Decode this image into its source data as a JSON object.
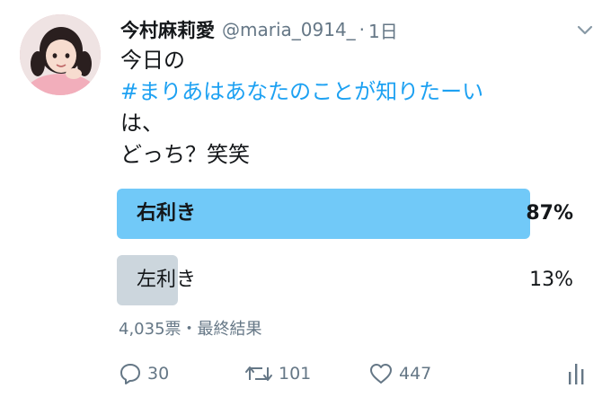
{
  "tweet": {
    "display_name": "今村麻莉愛",
    "handle": "@maria_0914_",
    "separator": "·",
    "time": "1日",
    "text_lines": [
      "今日の",
      "#まりあはあなたのことが知りたーい",
      "は、",
      "どっち？笑笑"
    ]
  },
  "poll": {
    "options": [
      {
        "label": "右利き",
        "percent_text": "87%",
        "percent": 87,
        "winner": true
      },
      {
        "label": "左利き",
        "percent_text": "13%",
        "percent": 13,
        "winner": false
      }
    ],
    "meta": "4,035票・最終結果"
  },
  "actions": {
    "reply_count": "30",
    "retweet_count": "101",
    "like_count": "447"
  },
  "icons": {
    "caret": "chevron-down-icon",
    "reply": "reply-icon",
    "retweet": "retweet-icon",
    "like": "heart-icon",
    "analytics": "analytics-icon"
  },
  "colors": {
    "hashtag": "#1da1f2",
    "poll_winner": "#71c9f8",
    "poll_other": "#ccd6dd",
    "muted": "#657786"
  }
}
